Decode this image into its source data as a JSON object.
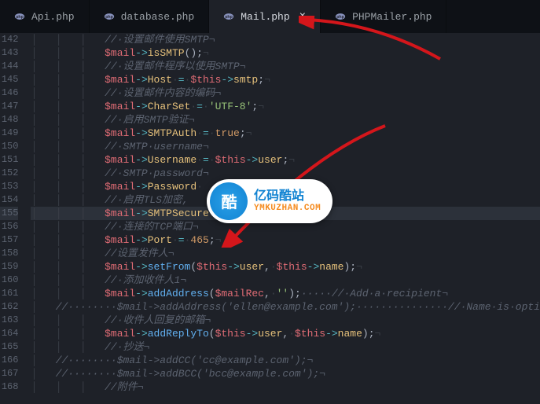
{
  "tabs": [
    {
      "label": "Api.php",
      "active": false,
      "close": false
    },
    {
      "label": "database.php",
      "active": false,
      "close": false
    },
    {
      "label": "Mail.php",
      "active": true,
      "close": true
    },
    {
      "label": "PHPMailer.php",
      "active": false,
      "close": false
    }
  ],
  "close_glyph": "×",
  "gutter_start": 142,
  "gutter_end": 168,
  "highlight_line": 155,
  "code": {
    "142": {
      "i": 3,
      "type": "cm",
      "text": "//·设置邮件使用SMTP¬"
    },
    "143": {
      "i": 3,
      "type": "call0",
      "prop": "isSMTP"
    },
    "144": {
      "i": 3,
      "type": "cm",
      "text": "//·设置邮件程序以使用SMTP¬"
    },
    "145": {
      "i": 3,
      "type": "assign_this",
      "prop": "Host",
      "rhs": "smtp"
    },
    "146": {
      "i": 3,
      "type": "cm",
      "text": "//·设置邮件内容的编码¬"
    },
    "147": {
      "i": 3,
      "type": "assign_str",
      "prop": "CharSet",
      "str": "'UTF-8'"
    },
    "148": {
      "i": 3,
      "type": "cm",
      "text": "//·启用SMTP验证¬"
    },
    "149": {
      "i": 3,
      "type": "assign_bool",
      "prop": "SMTPAuth",
      "bool": "true"
    },
    "150": {
      "i": 3,
      "type": "cm",
      "text": "//·SMTP·username¬"
    },
    "151": {
      "i": 3,
      "type": "assign_this",
      "prop": "Username",
      "rhs": "user"
    },
    "152": {
      "i": 3,
      "type": "cm",
      "text": "//·SMTP·password¬"
    },
    "153": {
      "i": 3,
      "type": "assign_this_trunc",
      "prop": "Password"
    },
    "154": {
      "i": 3,
      "type": "cm",
      "text": "//·启用TLS加密,"
    },
    "155": {
      "i": 3,
      "type": "assign_trunc",
      "prop": "SMTPSecure"
    },
    "156": {
      "i": 3,
      "type": "cm",
      "text": "//·连接的TCP端口¬"
    },
    "157": {
      "i": 3,
      "type": "assign_num",
      "prop": "Port",
      "num": "465"
    },
    "158": {
      "i": 3,
      "type": "cm",
      "text": "//设置发件人¬"
    },
    "159": {
      "i": 3,
      "type": "setFrom"
    },
    "160": {
      "i": 3,
      "type": "cm",
      "text": "//·添加收件人1¬"
    },
    "161": {
      "i": 3,
      "type": "addAddress",
      "tail": "·····//·Add·a·recipient¬"
    },
    "162": {
      "i": 1,
      "type": "cm_line",
      "text": "//········$mail->addAddress('ellen@example.com');···············//·Name·is·opti"
    },
    "163": {
      "i": 3,
      "type": "cm",
      "text": "//·收件人回复的邮箱¬"
    },
    "164": {
      "i": 3,
      "type": "addReplyTo"
    },
    "165": {
      "i": 3,
      "type": "cm",
      "text": "//·抄送¬"
    },
    "166": {
      "i": 1,
      "type": "cm_line",
      "text": "//········$mail->addCC('cc@example.com');¬"
    },
    "167": {
      "i": 1,
      "type": "cm_line",
      "text": "//········$mail->addBCC('bcc@example.com');¬"
    },
    "168": {
      "i": 3,
      "type": "cm",
      "text": "//附件¬"
    }
  },
  "strings": {
    "mail": "$mail",
    "this": "$this",
    "mailRec": "$mailRec",
    "setFrom": "setFrom",
    "addAddress": "addAddress",
    "addReplyTo": "addReplyTo",
    "user": "user",
    "name": "name",
    "empty": "''"
  },
  "watermark": {
    "badge": "酷",
    "top": "亿码酷站",
    "bottom": "YMKUZHAN.COM"
  }
}
